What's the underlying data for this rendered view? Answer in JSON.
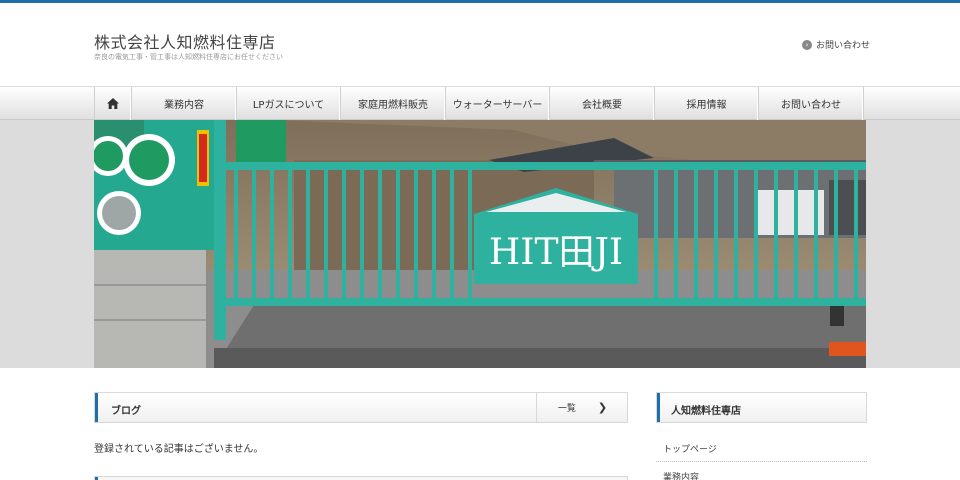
{
  "header": {
    "site_title": "株式会社人知燃料住専店",
    "site_description": "奈良の電気工事・管工事は人知燃料住専店にお任せください",
    "contact_link": "お問い合わせ"
  },
  "nav": {
    "items": [
      "業務内容",
      "LPガスについて",
      "家庭用燃料販売",
      "ウォーターサーバー",
      "会社概要",
      "採用情報",
      "お問い合わせ"
    ]
  },
  "hero": {
    "sign_text": "HIT田JI"
  },
  "blog": {
    "title": "ブログ",
    "more_label": "一覧",
    "empty_message": "登録されている記事はございません。"
  },
  "sidebar": {
    "title": "人知燃料住専店",
    "links": [
      "トップページ",
      "業務内容"
    ]
  },
  "colors": {
    "accent": "#1f6fa8",
    "gate": "#2fb1a0"
  }
}
